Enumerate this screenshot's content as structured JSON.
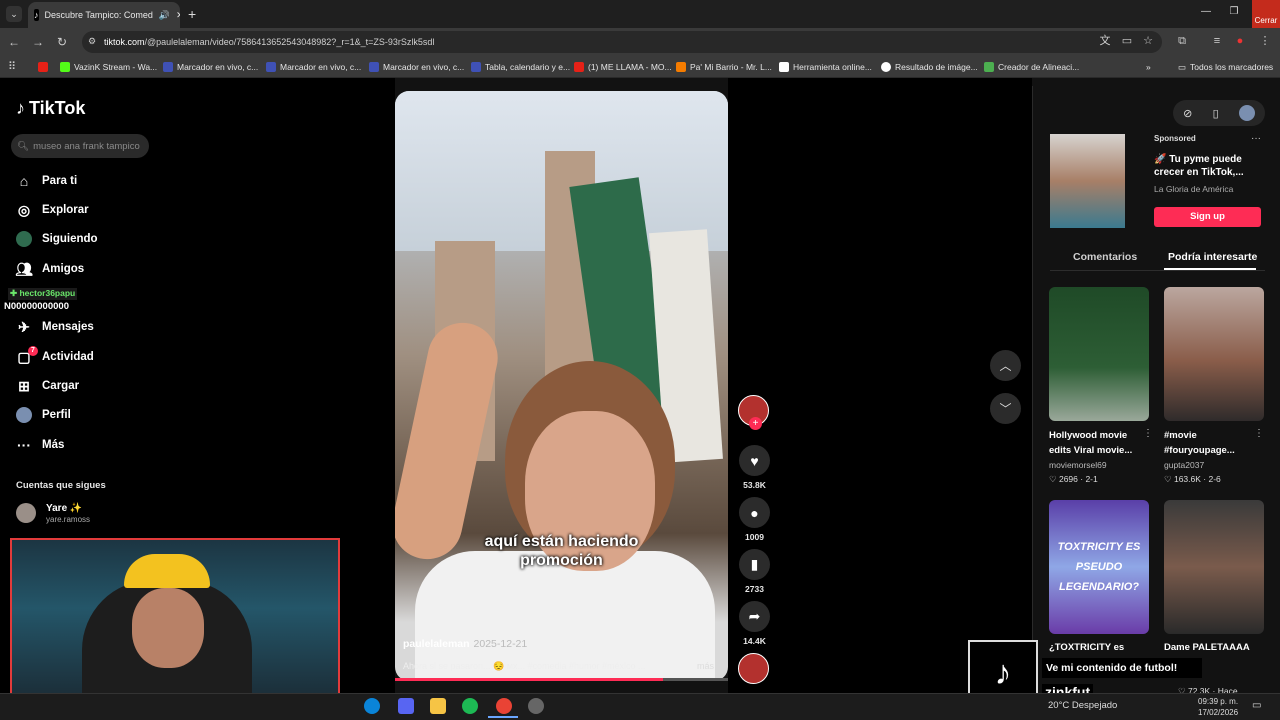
{
  "browser": {
    "tab_title": "Descubre Tampico: Comed",
    "close_label": "Cerrar",
    "url_host": "tiktok.com",
    "url_path": "/@paulelaleman/video/7586413652543048982?_r=1&_t=ZS-93rSzlk5sdl",
    "bookmarks": [
      "VazinK Stream - Wa...",
      "Marcador en vivo, c...",
      "Marcador en vivo, c...",
      "Marcador en vivo, c...",
      "Tabla, calendario y e...",
      "(1) ME LLAMA - MO...",
      "Pa' Mi Barrio - Mr. L...",
      "Herramienta online...",
      "Resultado de imáge...",
      "Creador de Alineaci..."
    ],
    "all_bookmarks": "Todos los marcadores"
  },
  "sidebar": {
    "logo": "TikTok",
    "search_placeholder": "museo ana frank tampico",
    "items": [
      {
        "label": "Para ti",
        "icon": "home-icon"
      },
      {
        "label": "Explorar",
        "icon": "compass-icon"
      },
      {
        "label": "Siguiendo",
        "icon": "following-avatar-icon"
      },
      {
        "label": "Amigos",
        "icon": "friends-icon"
      },
      {
        "label": "Mensajes",
        "icon": "messages-icon"
      },
      {
        "label": "Actividad",
        "icon": "activity-icon"
      },
      {
        "label": "Cargar",
        "icon": "upload-icon"
      },
      {
        "label": "Perfil",
        "icon": "profile-icon"
      },
      {
        "label": "Más",
        "icon": "more-icon"
      }
    ],
    "activity_badge": "7",
    "following_title": "Cuentas que sigues",
    "following": [
      {
        "name": "Yare ✨",
        "handle": "yare.ramoss"
      }
    ]
  },
  "stream_overlay": {
    "user_tag": "hector36papu",
    "zero_text": "N00000000000"
  },
  "video": {
    "caption_line1": "aquí están haciendo",
    "caption_line2": "promoción",
    "author": "paulelaleman",
    "date": "2025-12-21",
    "description": "Ahora si se pasaron... 😔 ᴍx... #comedia #humor #méxico ...",
    "more": "más"
  },
  "actions": {
    "likes": "53.8K",
    "comments": "1009",
    "saves": "2733",
    "shares": "14.4K"
  },
  "right_panel": {
    "sponsored": "Sponsored",
    "ad_title": "🚀 Tu pyme puede crecer en TikTok,...",
    "ad_brand": "La Gloria de América",
    "ad_button": "Sign up",
    "tabs": [
      "Comentarios",
      "Podría interesarte"
    ],
    "cards": [
      {
        "title": "Hollywood movie edits Viral movie...",
        "author": "moviemorsel69",
        "stats": "♡ 2696 · 2-1"
      },
      {
        "title": "#movie #fouryoupage...",
        "author": "gupta2037",
        "stats": "♡ 163.6K · 2-6"
      },
      {
        "title": "¿TOXTRICITY es",
        "author": "",
        "stats": ""
      },
      {
        "title": "Dame PALETAAAA",
        "author": "",
        "stats": "♡ 72.3K · Hace"
      }
    ],
    "thumb_text": "TOXTRICITY ES PSEUDO LEGENDARIO?"
  },
  "promo": {
    "text": "Ve mi contenido de futbol!",
    "handle": "zinkfut"
  },
  "taskbar": {
    "weather": "20°C  Despejado",
    "time": "09:39 p. m.",
    "date": "17/02/2026"
  }
}
